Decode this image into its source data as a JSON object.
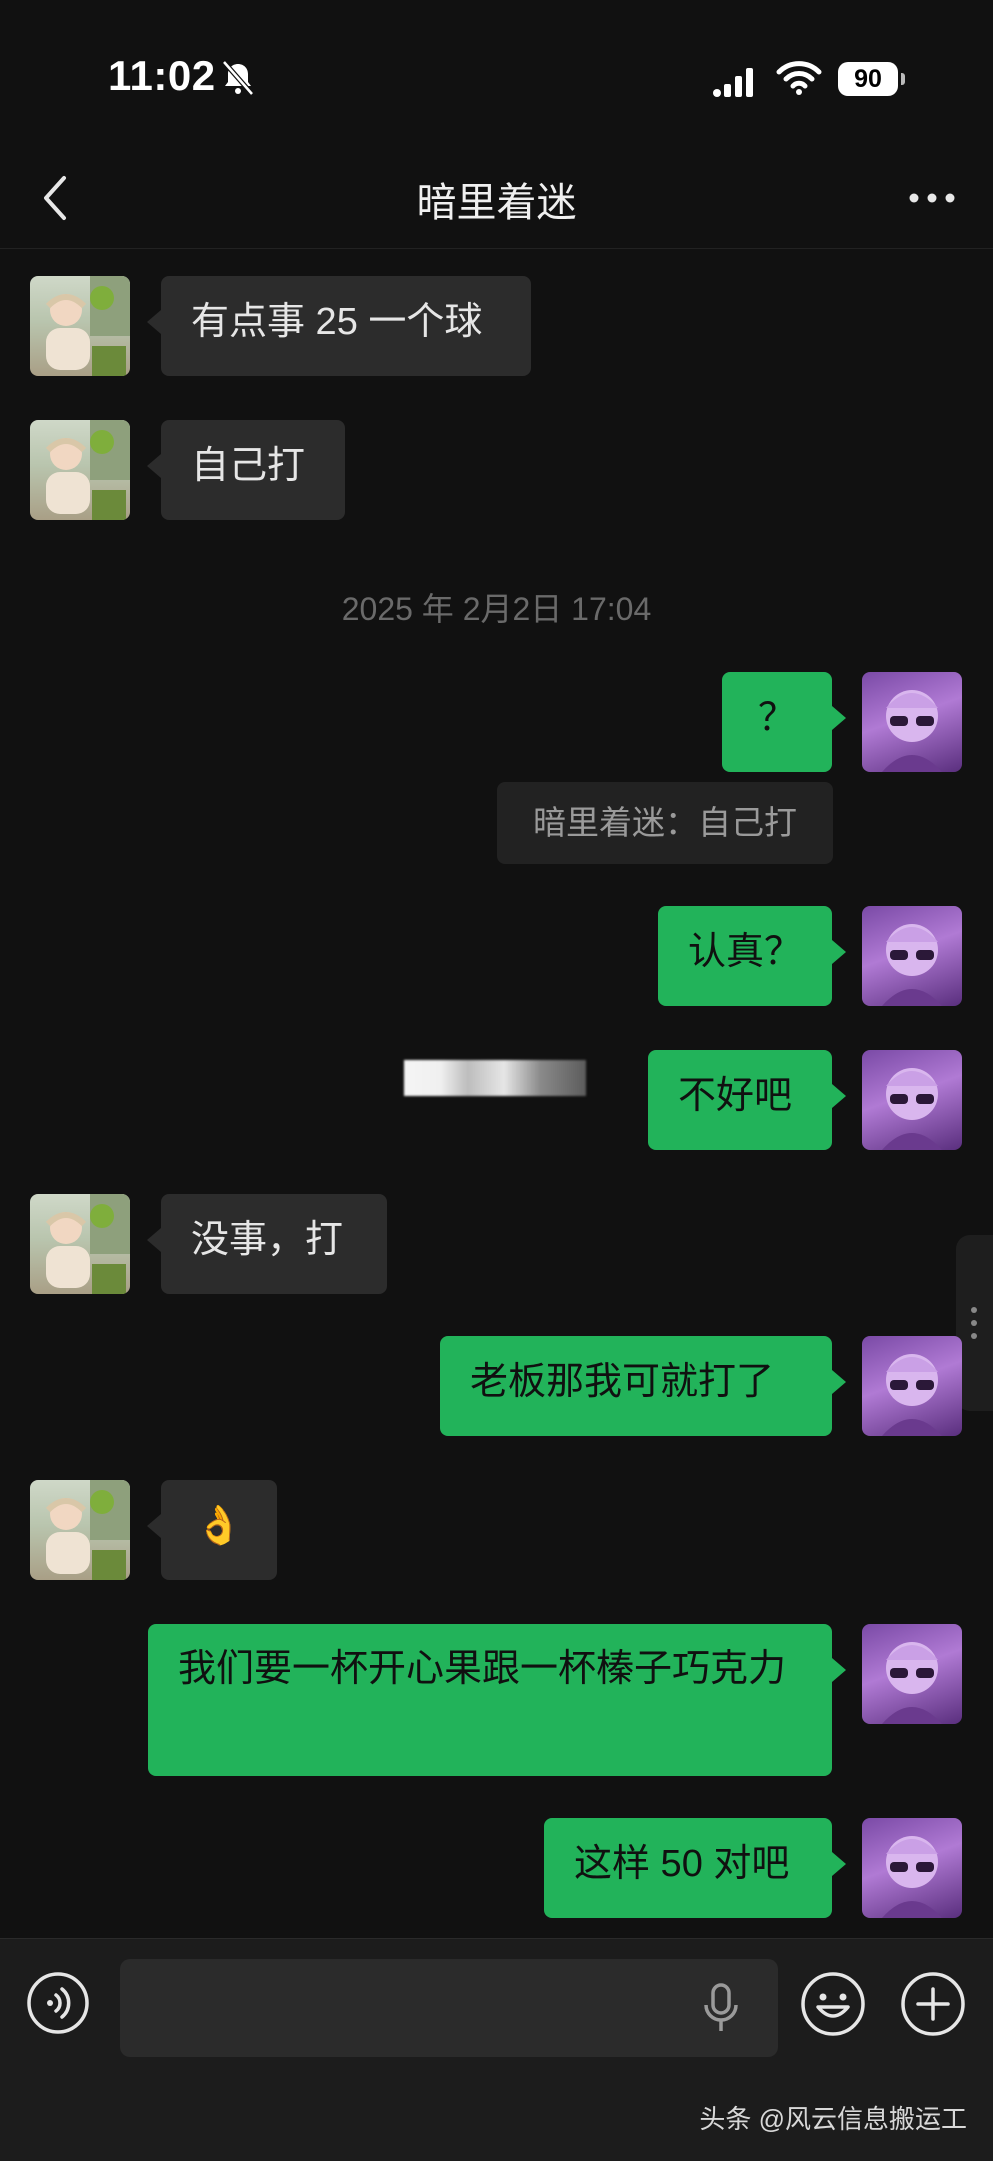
{
  "status_bar": {
    "time": "11:02",
    "battery": "90"
  },
  "nav": {
    "title": "暗里着迷"
  },
  "messages": [
    {
      "side": "received",
      "text": "有点事 25 一个球"
    },
    {
      "side": "received",
      "text": "自己打"
    },
    {
      "side": "sent",
      "text": "？"
    },
    {
      "side": "sent",
      "text": "认真？"
    },
    {
      "side": "sent",
      "text": "不好吧"
    },
    {
      "side": "received",
      "text": "没事，打"
    },
    {
      "side": "sent",
      "text": "老板那我可就打了"
    },
    {
      "side": "received",
      "text": "👌"
    },
    {
      "side": "sent",
      "text": "我们要一杯开心果跟一杯榛子巧克力"
    },
    {
      "side": "sent",
      "text": "这样 50 对吧"
    }
  ],
  "timestamp": "2025 年 2月2日 17:04",
  "quote": "暗里着迷：自己打",
  "input": {
    "value": ""
  },
  "watermark": "头条 @风云信息搬运工",
  "colors": {
    "sent_bubble": "#22b35a",
    "received_bubble": "#2c2c2c",
    "background": "#111111"
  }
}
